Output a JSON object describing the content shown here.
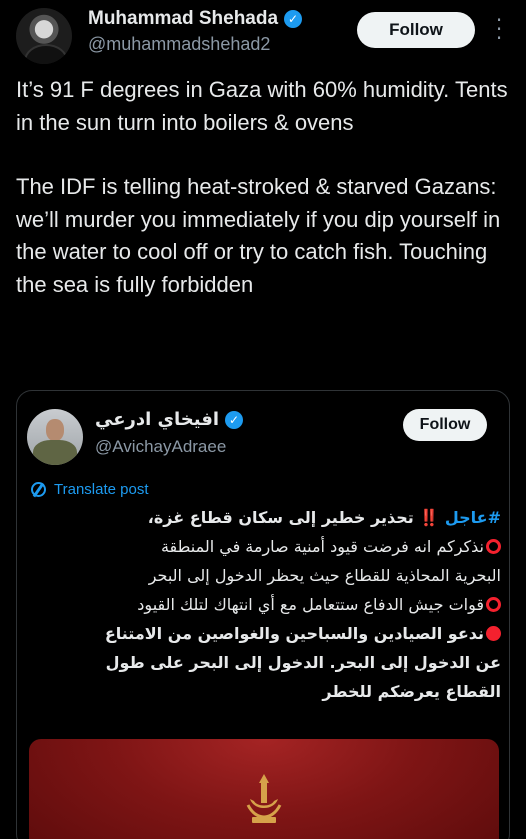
{
  "tweet": {
    "author": {
      "name": "Muhammad Shehada",
      "handle": "@muhammadshehad2"
    },
    "follow_label": "Follow",
    "text": [
      "It’s 91 F degrees in Gaza with 60% humidity. Tents in the sun turn into boilers & ovens",
      "The IDF is telling heat-stroked & starved Gazans: we’ll murder you immediately if you dip yourself in the water to cool off or try to catch fish. Touching the sea is fully forbidden"
    ]
  },
  "quote": {
    "author": {
      "name": "افيخاي ادرعي",
      "handle": "@AvichayAdraee"
    },
    "follow_label": "Follow",
    "translate_label": "Translate post",
    "lines": {
      "l1_hash": "#عاجل",
      "l1_bang": "‼️",
      "l1_text": "تحذير خطير إلى سكان قطاع غزة،",
      "l2": "نذكركم انه فرضت قيود أمنية صارمة في المنطقة",
      "l3": "البحرية المحاذية للقطاع حيث يحظر الدخول إلى البحر",
      "l4": "قوات جيش الدفاع ستتعامل مع أي انتهاك لتلك القيود",
      "l5": "ندعو الصيادين والسباحين والغواصين من الامتناع",
      "l6": "عن الدخول إلى البحر. الدخول إلى البحر على طول",
      "l7": "القطاع يعرضكم للخطر"
    }
  },
  "colors": {
    "accent": "#1d9bf0",
    "danger": "#f4212e",
    "background": "#000000",
    "card_red": "#7f1515"
  },
  "icons": [
    "verified-badge-icon",
    "more-options-icon",
    "translate-icon",
    "idf-emblem-icon"
  ]
}
